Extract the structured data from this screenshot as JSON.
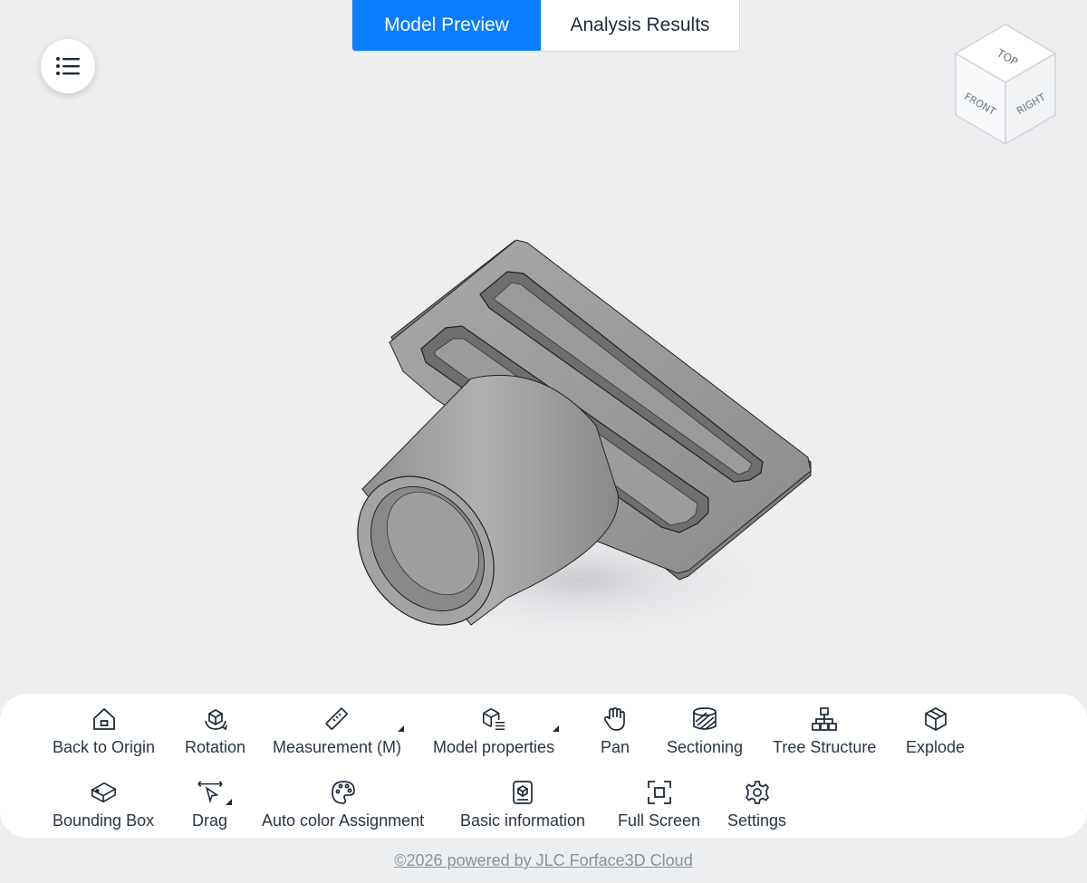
{
  "tabs": [
    {
      "label": "Model Preview",
      "active": true
    },
    {
      "label": "Analysis Results",
      "active": false
    }
  ],
  "menu_button": {
    "icon": "list-icon"
  },
  "viewcube": {
    "top": "TOP",
    "front": "FRONT",
    "right": "RIGHT"
  },
  "toolbar": {
    "row1": [
      {
        "label": "Back to Origin",
        "icon": "home-icon"
      },
      {
        "label": "Rotation",
        "icon": "rotate-cube-icon"
      },
      {
        "label": "Measurement (M)",
        "icon": "ruler-icon"
      },
      {
        "label": "Model properties",
        "icon": "cube-list-icon"
      },
      {
        "label": "Pan",
        "icon": "hand-icon"
      },
      {
        "label": "Sectioning",
        "icon": "section-cylinder-icon"
      },
      {
        "label": "Tree Structure",
        "icon": "tree-icon"
      },
      {
        "label": "Explode",
        "icon": "explode-cube-icon"
      }
    ],
    "row2": [
      {
        "label": "Bounding Box",
        "icon": "bounding-box-icon"
      },
      {
        "label": "Drag",
        "icon": "drag-cursor-icon"
      },
      {
        "label": "Auto color Assignment",
        "icon": "palette-icon"
      },
      {
        "label": "Basic information",
        "icon": "info-doc-icon"
      },
      {
        "label": "Full Screen",
        "icon": "fullscreen-icon"
      },
      {
        "label": "Settings",
        "icon": "gear-icon"
      }
    ]
  },
  "footer": {
    "text": "©2026 powered by JLC Forface3D Cloud"
  },
  "colors": {
    "accent": "#0a7cff",
    "background": "#eceef0",
    "model": "#9a9a9a"
  }
}
